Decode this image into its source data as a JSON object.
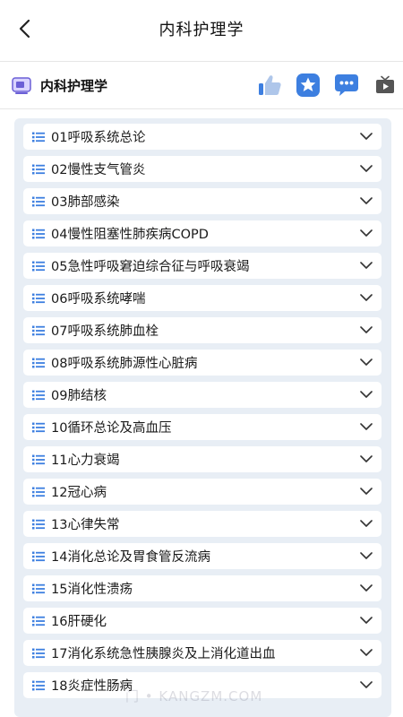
{
  "header": {
    "title": "内科护理学"
  },
  "course": {
    "name": "内科护理学"
  },
  "actions": [
    {
      "icon": "thumbs-up-icon"
    },
    {
      "icon": "star-icon"
    },
    {
      "icon": "chat-icon"
    },
    {
      "icon": "tv-icon"
    }
  ],
  "chapters": [
    {
      "label": "01呼吸系统总论"
    },
    {
      "label": "02慢性支气管炎"
    },
    {
      "label": "03肺部感染"
    },
    {
      "label": "04慢性阻塞性肺疾病COPD"
    },
    {
      "label": "05急性呼吸窘迫综合征与呼吸衰竭"
    },
    {
      "label": "06呼吸系统哮喘"
    },
    {
      "label": "07呼吸系统肺血栓"
    },
    {
      "label": "08呼吸系统肺源性心脏病"
    },
    {
      "label": "09肺结核"
    },
    {
      "label": "10循环总论及高血压"
    },
    {
      "label": "11心力衰竭"
    },
    {
      "label": "12冠心病"
    },
    {
      "label": "13心律失常"
    },
    {
      "label": "14消化总论及胃食管反流病"
    },
    {
      "label": "15消化性溃疡"
    },
    {
      "label": "16肝硬化"
    },
    {
      "label": "17消化系统急性胰腺炎及上消化道出血"
    },
    {
      "label": "18炎症性肠病"
    }
  ],
  "watermark": "门 • KANGZM.COM",
  "colors": {
    "accent": "#2f7de1",
    "list_bg": "#e8eef5"
  }
}
